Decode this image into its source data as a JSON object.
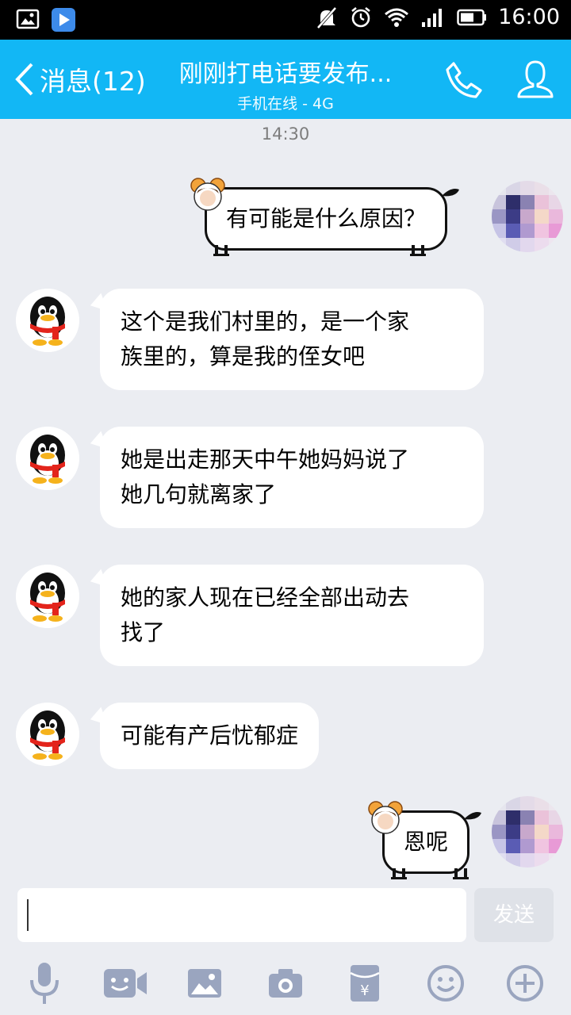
{
  "status_bar": {
    "time": "16:00"
  },
  "header": {
    "back_label": "消息(12)",
    "title": "刚刚打电话要发布...",
    "subtitle": "手机在线 - 4G"
  },
  "chat": {
    "timestamp": "14:30",
    "messages": [
      {
        "side": "out",
        "text": "有可能是什么原因？"
      },
      {
        "side": "in",
        "lines": [
          "这个是我们村里的，是一个家",
          "族里的，算是我的侄女吧"
        ]
      },
      {
        "side": "in",
        "lines": [
          "她是出走那天中午她妈妈说了",
          "她几句就离家了"
        ]
      },
      {
        "side": "in",
        "lines": [
          "她的家人现在已经全部出动去",
          "找了"
        ]
      },
      {
        "side": "in",
        "lines": [
          "可能有产后忧郁症"
        ]
      },
      {
        "side": "out",
        "text": "恩呢"
      }
    ]
  },
  "composer": {
    "input_value": "",
    "send_label": "发送"
  },
  "toolbar_icons": [
    "microphone-icon",
    "video-icon",
    "image-icon",
    "camera-icon",
    "red-packet-icon",
    "emoji-icon",
    "plus-icon"
  ],
  "colors": {
    "header": "#12b7f5",
    "background": "#ebedf2",
    "toolbar_icon": "#9aa5bf"
  }
}
